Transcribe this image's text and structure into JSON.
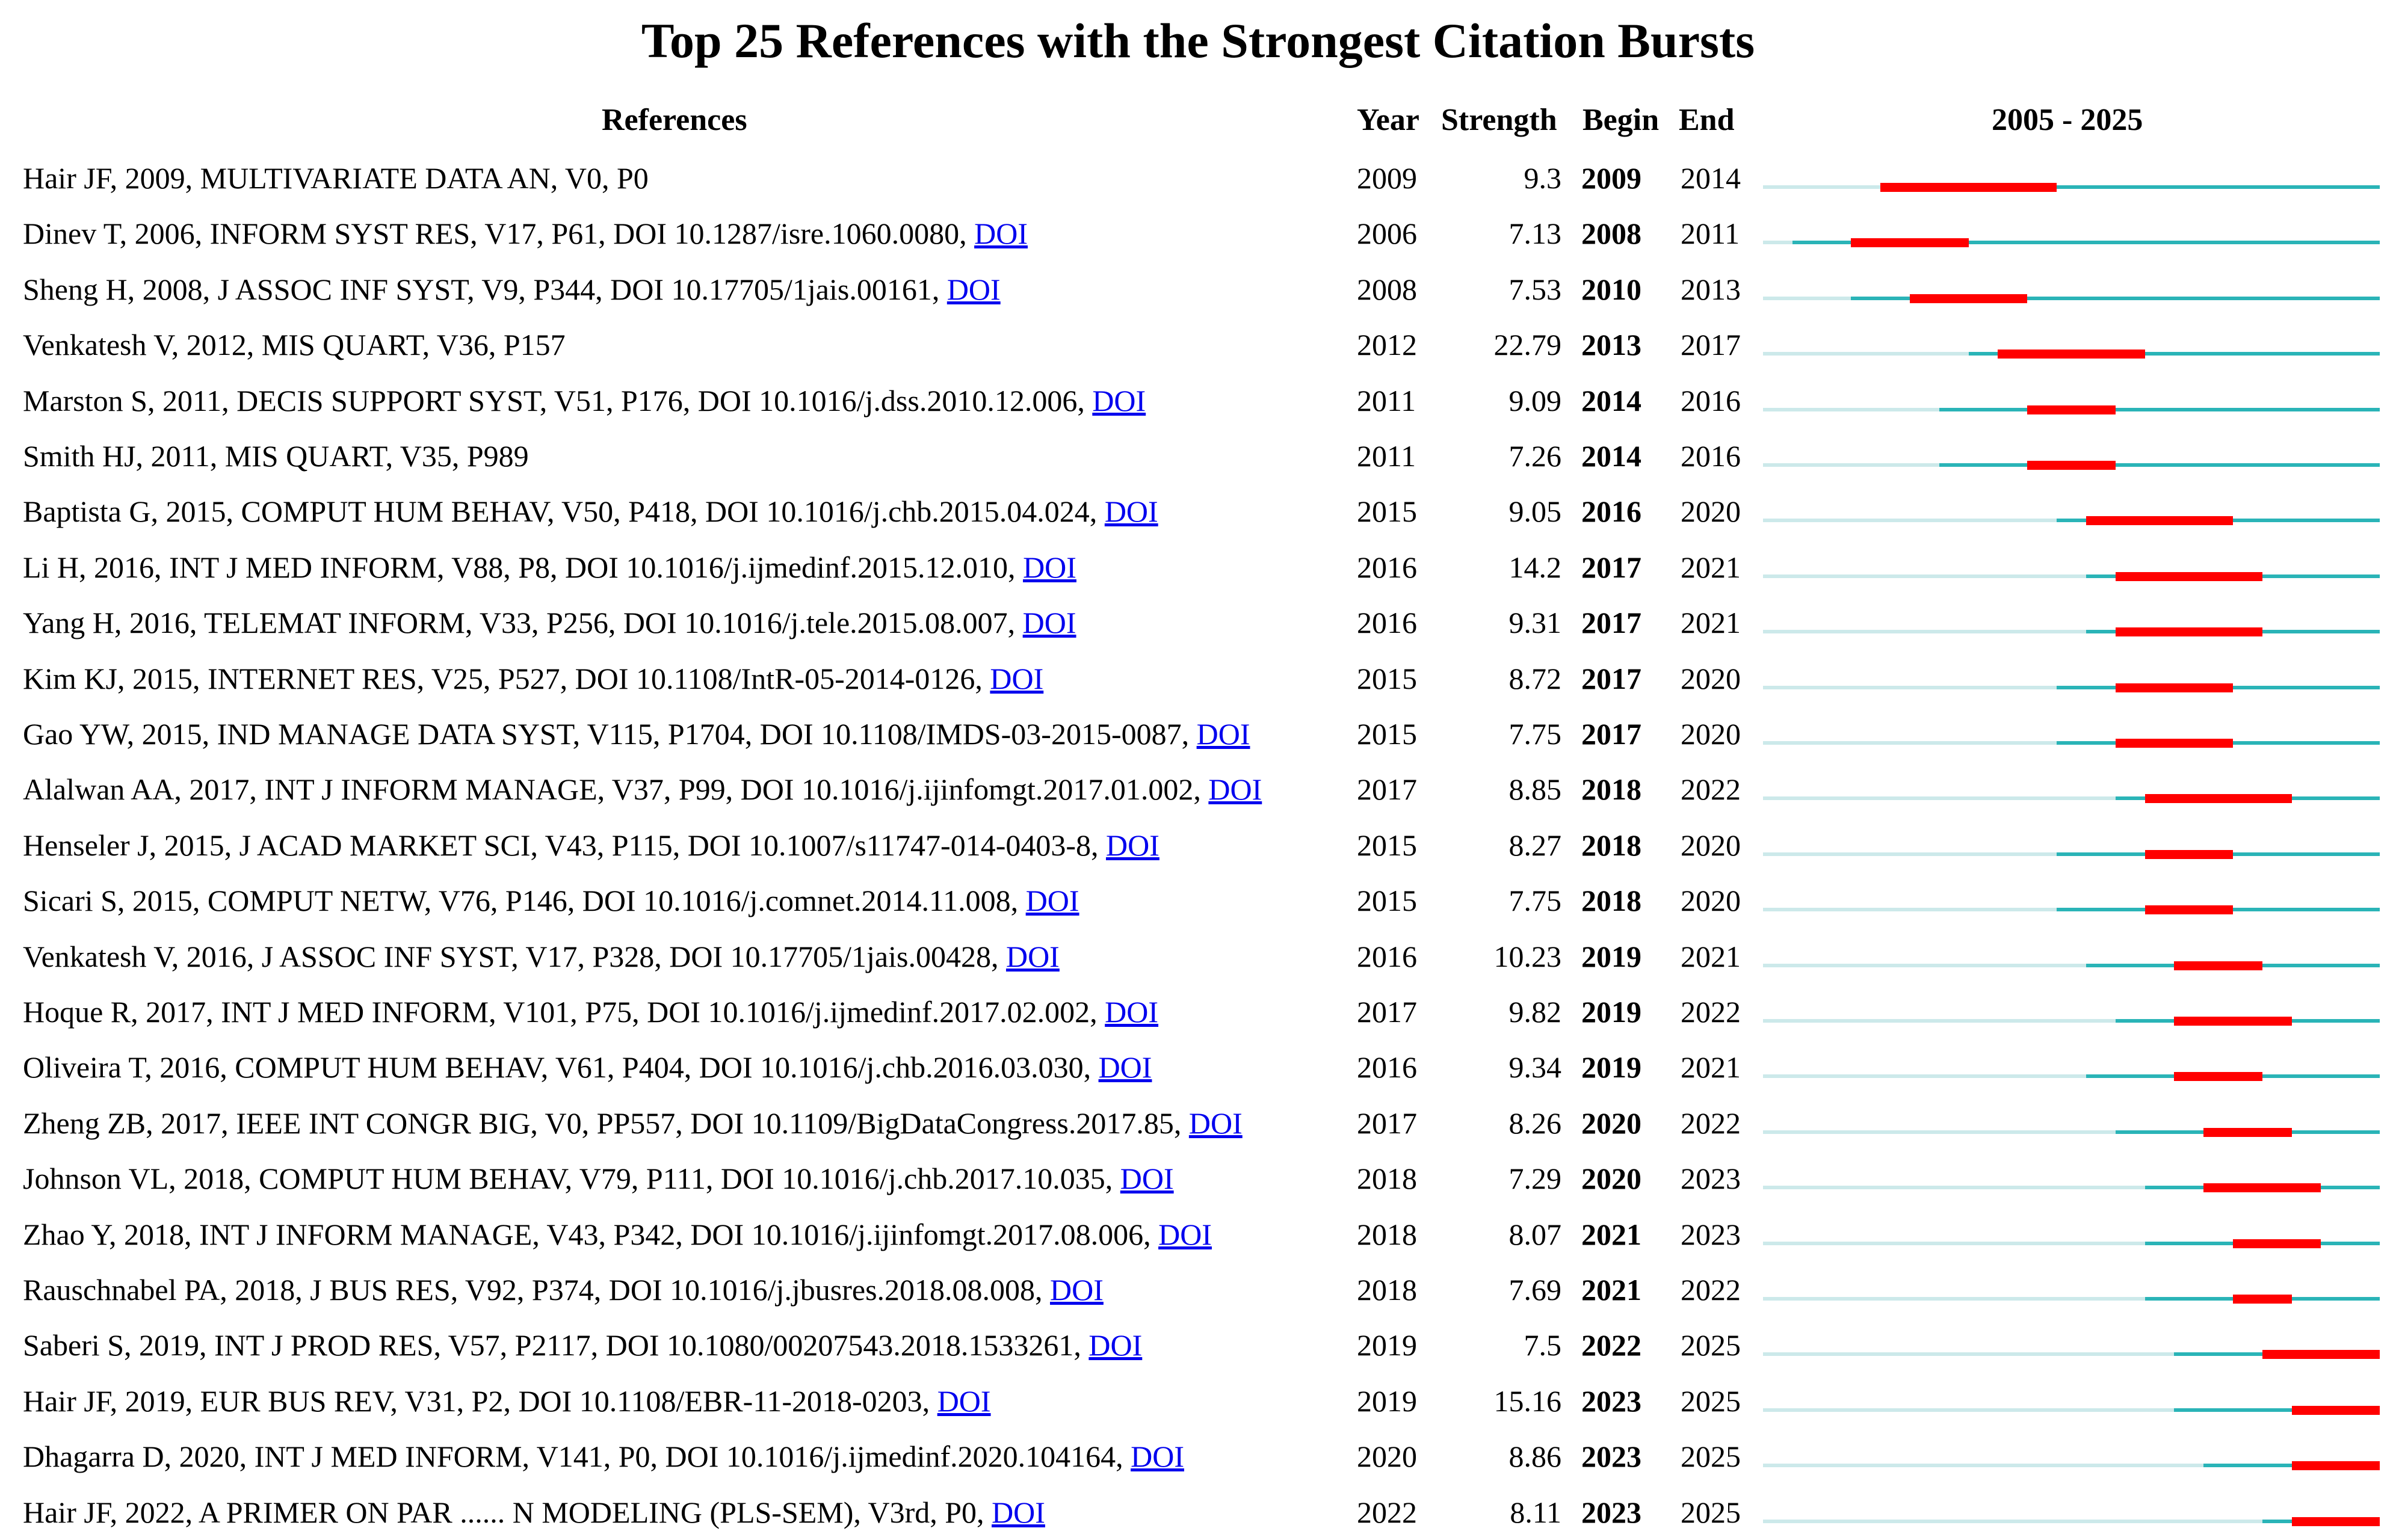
{
  "title": "Top 25 References with the Strongest Citation Bursts",
  "headers": {
    "references": "References",
    "year": "Year",
    "strength": "Strength",
    "begin": "Begin",
    "end": "End",
    "range": "2005 - 2025"
  },
  "colors": {
    "inactive": "#cce9ea",
    "active": "#2ab4b7",
    "burst": "#ff0000",
    "link": "#0000ee"
  },
  "chart_data": {
    "type": "table",
    "title": "Top 25 References with the Strongest Citation Bursts",
    "timeline_range": [
      2005,
      2025
    ],
    "rows": [
      {
        "ref": "Hair JF, 2009, MULTIVARIATE DATA AN, V0, P0",
        "doi": "",
        "year": 2009,
        "strength": "9.3",
        "begin": 2009,
        "end": 2014
      },
      {
        "ref": "Dinev T, 2006, INFORM SYST RES, V17, P61, DOI 10.1287/isre.1060.0080, ",
        "doi": "DOI",
        "year": 2006,
        "strength": "7.13",
        "begin": 2008,
        "end": 2011
      },
      {
        "ref": "Sheng H, 2008, J ASSOC INF SYST, V9, P344, DOI 10.17705/1jais.00161, ",
        "doi": "DOI",
        "year": 2008,
        "strength": "7.53",
        "begin": 2010,
        "end": 2013
      },
      {
        "ref": "Venkatesh V, 2012, MIS QUART, V36, P157",
        "doi": "",
        "year": 2012,
        "strength": "22.79",
        "begin": 2013,
        "end": 2017
      },
      {
        "ref": "Marston S, 2011, DECIS SUPPORT SYST, V51, P176, DOI 10.1016/j.dss.2010.12.006, ",
        "doi": "DOI",
        "year": 2011,
        "strength": "9.09",
        "begin": 2014,
        "end": 2016
      },
      {
        "ref": "Smith HJ, 2011, MIS QUART, V35, P989",
        "doi": "",
        "year": 2011,
        "strength": "7.26",
        "begin": 2014,
        "end": 2016
      },
      {
        "ref": "Baptista G, 2015, COMPUT HUM BEHAV, V50, P418, DOI 10.1016/j.chb.2015.04.024, ",
        "doi": "DOI",
        "year": 2015,
        "strength": "9.05",
        "begin": 2016,
        "end": 2020
      },
      {
        "ref": "Li H, 2016, INT J MED INFORM, V88, P8, DOI 10.1016/j.ijmedinf.2015.12.010, ",
        "doi": "DOI",
        "year": 2016,
        "strength": "14.2",
        "begin": 2017,
        "end": 2021
      },
      {
        "ref": "Yang H, 2016, TELEMAT INFORM, V33, P256, DOI 10.1016/j.tele.2015.08.007, ",
        "doi": "DOI",
        "year": 2016,
        "strength": "9.31",
        "begin": 2017,
        "end": 2021
      },
      {
        "ref": "Kim KJ, 2015, INTERNET RES, V25, P527, DOI 10.1108/IntR-05-2014-0126, ",
        "doi": "DOI",
        "year": 2015,
        "strength": "8.72",
        "begin": 2017,
        "end": 2020
      },
      {
        "ref": "Gao YW, 2015, IND MANAGE DATA SYST, V115, P1704, DOI 10.1108/IMDS-03-2015-0087, ",
        "doi": "DOI",
        "year": 2015,
        "strength": "7.75",
        "begin": 2017,
        "end": 2020
      },
      {
        "ref": "Alalwan AA, 2017, INT J INFORM MANAGE, V37, P99, DOI 10.1016/j.ijinfomgt.2017.01.002, ",
        "doi": "DOI",
        "year": 2017,
        "strength": "8.85",
        "begin": 2018,
        "end": 2022
      },
      {
        "ref": "Henseler J, 2015, J ACAD MARKET SCI, V43, P115, DOI 10.1007/s11747-014-0403-8, ",
        "doi": "DOI",
        "year": 2015,
        "strength": "8.27",
        "begin": 2018,
        "end": 2020
      },
      {
        "ref": "Sicari S, 2015, COMPUT NETW, V76, P146, DOI 10.1016/j.comnet.2014.11.008, ",
        "doi": "DOI",
        "year": 2015,
        "strength": "7.75",
        "begin": 2018,
        "end": 2020
      },
      {
        "ref": "Venkatesh V, 2016, J ASSOC INF SYST, V17, P328, DOI 10.17705/1jais.00428, ",
        "doi": "DOI",
        "year": 2016,
        "strength": "10.23",
        "begin": 2019,
        "end": 2021
      },
      {
        "ref": "Hoque R, 2017, INT J MED INFORM, V101, P75, DOI 10.1016/j.ijmedinf.2017.02.002, ",
        "doi": "DOI",
        "year": 2017,
        "strength": "9.82",
        "begin": 2019,
        "end": 2022
      },
      {
        "ref": "Oliveira T, 2016, COMPUT HUM BEHAV, V61, P404, DOI 10.1016/j.chb.2016.03.030, ",
        "doi": "DOI",
        "year": 2016,
        "strength": "9.34",
        "begin": 2019,
        "end": 2021
      },
      {
        "ref": "Zheng ZB, 2017, IEEE INT CONGR BIG, V0, PP557, DOI 10.1109/BigDataCongress.2017.85, ",
        "doi": "DOI",
        "year": 2017,
        "strength": "8.26",
        "begin": 2020,
        "end": 2022
      },
      {
        "ref": "Johnson VL, 2018, COMPUT HUM BEHAV, V79, P111, DOI 10.1016/j.chb.2017.10.035, ",
        "doi": "DOI",
        "year": 2018,
        "strength": "7.29",
        "begin": 2020,
        "end": 2023
      },
      {
        "ref": "Zhao Y, 2018, INT J INFORM MANAGE, V43, P342, DOI 10.1016/j.ijinfomgt.2017.08.006, ",
        "doi": "DOI",
        "year": 2018,
        "strength": "8.07",
        "begin": 2021,
        "end": 2023
      },
      {
        "ref": "Rauschnabel PA, 2018, J BUS RES, V92, P374, DOI 10.1016/j.jbusres.2018.08.008, ",
        "doi": "DOI",
        "year": 2018,
        "strength": "7.69",
        "begin": 2021,
        "end": 2022
      },
      {
        "ref": "Saberi S, 2019, INT J PROD RES, V57, P2117, DOI 10.1080/00207543.2018.1533261, ",
        "doi": "DOI",
        "year": 2019,
        "strength": "7.5",
        "begin": 2022,
        "end": 2025
      },
      {
        "ref": "Hair JF, 2019, EUR BUS REV, V31, P2, DOI 10.1108/EBR-11-2018-0203, ",
        "doi": "DOI",
        "year": 2019,
        "strength": "15.16",
        "begin": 2023,
        "end": 2025
      },
      {
        "ref": "Dhagarra D, 2020, INT J MED INFORM, V141, P0, DOI 10.1016/j.ijmedinf.2020.104164, ",
        "doi": "DOI",
        "year": 2020,
        "strength": "8.86",
        "begin": 2023,
        "end": 2025
      },
      {
        "ref": "Hair JF, 2022, A PRIMER ON PAR ...... N MODELING (PLS-SEM), V3rd, P0, ",
        "doi": "DOI",
        "year": 2022,
        "strength": "8.11",
        "begin": 2023,
        "end": 2025
      }
    ]
  }
}
